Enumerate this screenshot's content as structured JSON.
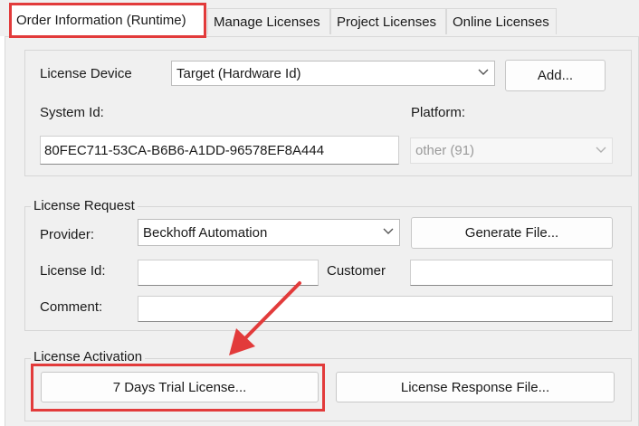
{
  "tabs": [
    {
      "label": "Order Information (Runtime)",
      "active": true
    },
    {
      "label": "Manage Licenses"
    },
    {
      "label": "Project Licenses"
    },
    {
      "label": "Online Licenses"
    }
  ],
  "device": {
    "label": "License Device",
    "combo_value": "Target (Hardware Id)",
    "add_label": "Add...",
    "system_id_label": "System Id:",
    "system_id_value": "80FEC711-53CA-B6B6-A1DD-96578EF8A444",
    "platform_label": "Platform:",
    "platform_value": "other (91)"
  },
  "request": {
    "legend": "License Request",
    "provider_label": "Provider:",
    "provider_value": "Beckhoff Automation",
    "generate_label": "Generate File...",
    "license_id_label": "License Id:",
    "license_id_value": "",
    "customer_label": "Customer",
    "customer_value": "",
    "comment_label": "Comment:",
    "comment_value": ""
  },
  "activation": {
    "legend": "License Activation",
    "trial_label": "7 Days Trial License...",
    "response_label": "License Response File..."
  },
  "annotation": {
    "color": "#e23b3b"
  }
}
